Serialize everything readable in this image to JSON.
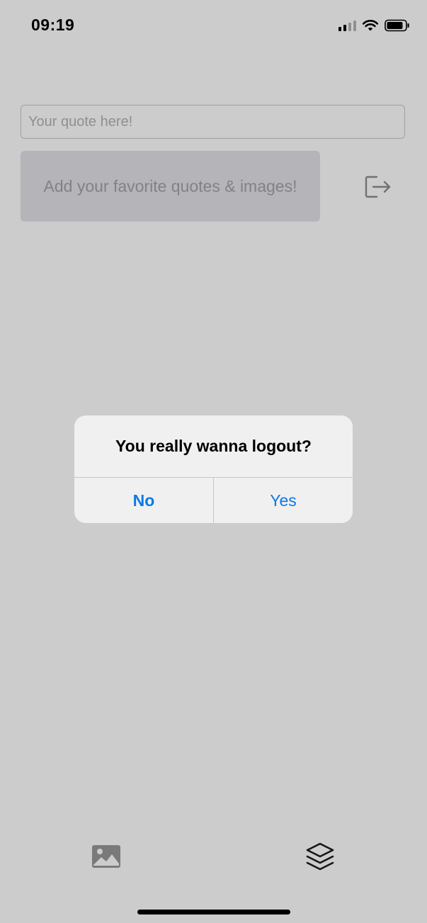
{
  "status_bar": {
    "time": "09:19",
    "icons": [
      "cellular-signal-icon",
      "wifi-icon",
      "battery-icon"
    ]
  },
  "quote_input": {
    "value": "",
    "placeholder": "Your quote here!"
  },
  "add_area": {
    "text": "Add your favorite quotes & images!"
  },
  "logout_button": {
    "icon": "logout-icon"
  },
  "tab_bar": {
    "items": [
      {
        "icon": "image-icon"
      },
      {
        "icon": "layers-icon"
      }
    ]
  },
  "alert": {
    "title": "You really wanna logout?",
    "no_label": "No",
    "yes_label": "Yes"
  },
  "colors": {
    "accent": "#0a7ae6",
    "overlay": "rgba(0,0,0,0.2)",
    "alert_background": "#f0f0f0",
    "add_area_background": "#e3e2e8"
  }
}
